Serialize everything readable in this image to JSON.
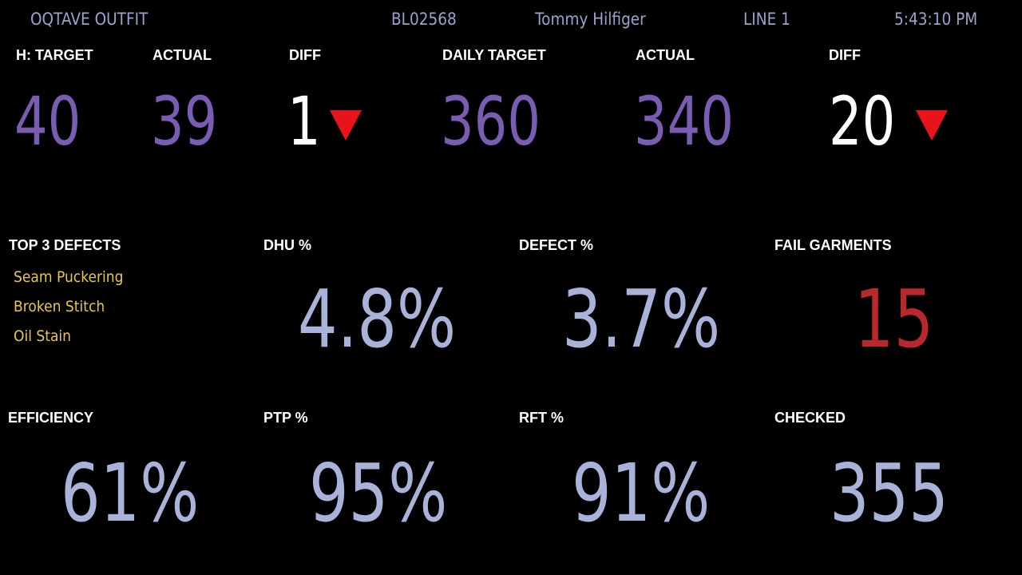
{
  "header": {
    "company": "OQTAVE OUTFIT",
    "style_code": "BL02568",
    "buyer": "Tommy Hilfiger",
    "line": "LINE 1",
    "time": "5:43:10 PM"
  },
  "hourly": {
    "target_label": "H: TARGET",
    "target_value": "40",
    "actual_label": "ACTUAL",
    "actual_value": "39",
    "diff_label": "DIFF",
    "diff_value": "1",
    "diff_icon": "down-triangle"
  },
  "daily": {
    "target_label": "DAILY TARGET",
    "target_value": "360",
    "actual_label": "ACTUAL",
    "actual_value": "340",
    "diff_label": "DIFF",
    "diff_value": "20",
    "diff_icon": "down-triangle"
  },
  "defects": {
    "label": "TOP 3 DEFECTS",
    "items": [
      "Seam Puckering",
      "Broken Stitch",
      "Oil Stain"
    ]
  },
  "dhu": {
    "label": "DHU %",
    "value": "4.8%"
  },
  "defect_pct": {
    "label": "DEFECT %",
    "value": "3.7%"
  },
  "fail_garments": {
    "label": "FAIL GARMENTS",
    "value": "15"
  },
  "efficiency": {
    "label": "EFFICIENCY",
    "value": "61%"
  },
  "ptp": {
    "label": "PTP %",
    "value": "95%"
  },
  "rft": {
    "label": "RFT %",
    "value": "91%"
  },
  "checked": {
    "label": "CHECKED",
    "value": "355"
  },
  "colors": {
    "background": "#000000",
    "header_text": "#9aa3cf",
    "target_purple": "#7b5cb3",
    "metric_lavender": "#a9b3d9",
    "alert_red": "#b8282d",
    "down_arrow": "#e8141c",
    "defect_yellow": "#e8c64a"
  }
}
